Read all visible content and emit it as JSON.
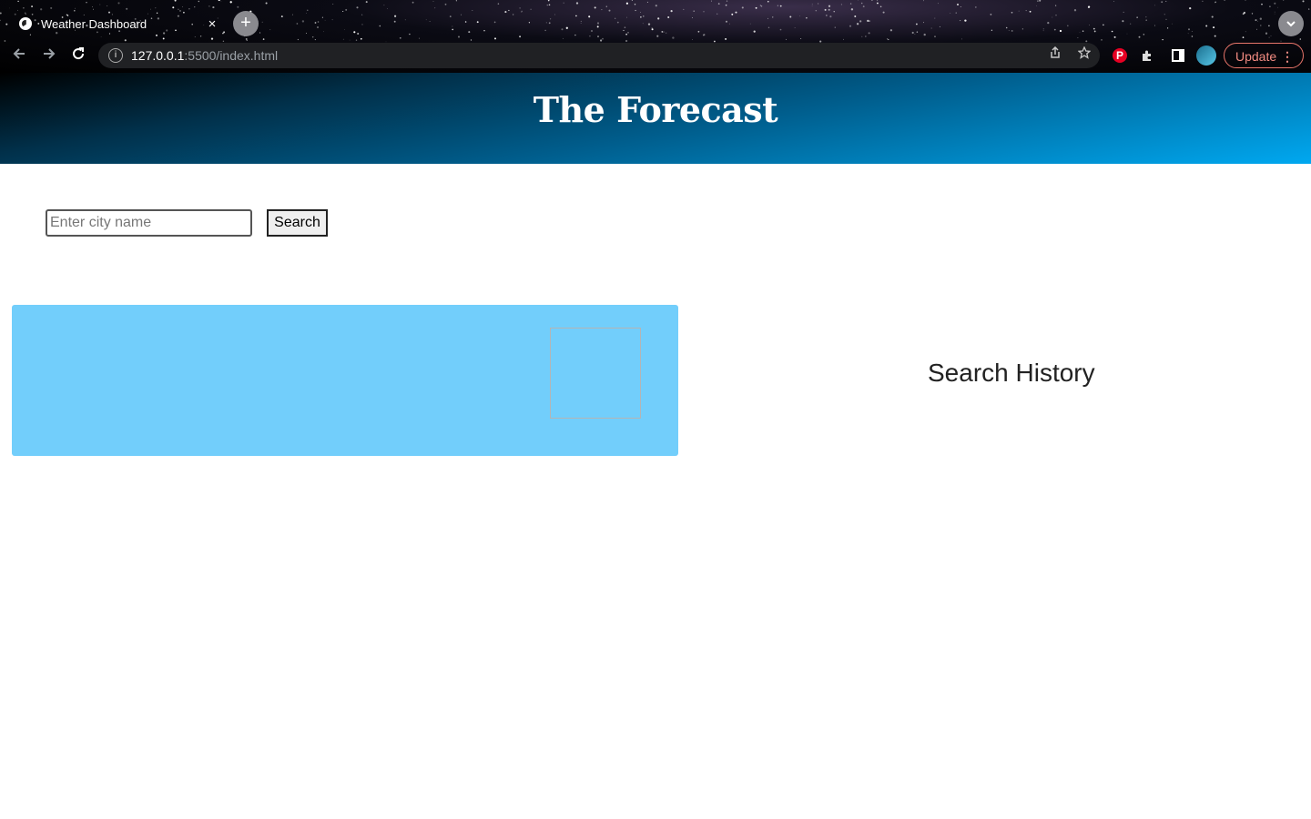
{
  "browser": {
    "tab_title": "Weather Dashboard",
    "tab_close_icon": "×",
    "new_tab_icon": "+",
    "url_host": "127.0.0.1",
    "url_rest": ":5500/index.html",
    "update_label": "Update",
    "accent_update": "#f28b82"
  },
  "header": {
    "title": "The Forecast"
  },
  "search": {
    "placeholder": "Enter city name",
    "value": "",
    "button_label": "Search"
  },
  "history": {
    "title": "Search History"
  },
  "colors": {
    "card_bg": "#72cefb",
    "banner_end": "#00a8f0"
  }
}
